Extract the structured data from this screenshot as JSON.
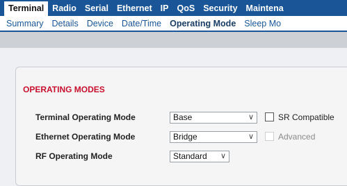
{
  "topnav": {
    "tabs": [
      "Terminal",
      "Radio",
      "Serial",
      "Ethernet",
      "IP",
      "QoS",
      "Security",
      "Maintena"
    ],
    "active": "Terminal"
  },
  "subnav": {
    "items": [
      "Summary",
      "Details",
      "Device",
      "Date/Time",
      "Operating Mode",
      "Sleep Mo"
    ],
    "active": "Operating Mode"
  },
  "section": {
    "title": "OPERATING MODES"
  },
  "rows": {
    "terminal": {
      "label": "Terminal Operating Mode",
      "value": "Base",
      "checkbox_label": "SR Compatible"
    },
    "ethernet": {
      "label": "Ethernet Operating Mode",
      "value": "Bridge",
      "checkbox_label": "Advanced"
    },
    "rf": {
      "label": "RF Operating Mode",
      "value": "Standard"
    }
  },
  "icons": {
    "dropdown": "chevron-down-icon"
  },
  "colors": {
    "nav_blue": "#1a5697",
    "section_red": "#c8102e",
    "band_gray": "#cdd1d6"
  }
}
